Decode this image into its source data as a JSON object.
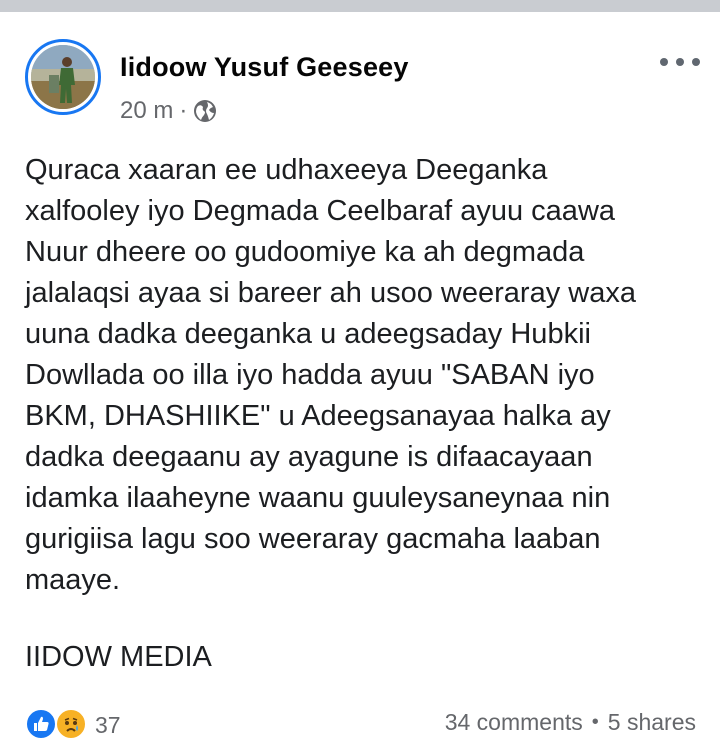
{
  "post": {
    "author": "Iidoow Yusuf Geeseey",
    "time": "20 m",
    "separator": "·",
    "privacy_icon": "globe-icon",
    "body": "Quraca xaaran ee udhaxeeya Deeganka\nxalfooley iyo Degmada Ceelbaraf ayuu caawa\nNuur dheere oo gudoomiye ka ah degmada\njalalaqsi ayaa si bareer ah usoo weeraray waxa\nuuna dadka deeganka u adeegsaday Hubkii\nDowllada oo illa iyo hadda ayuu \"SABAN iyo\nBKM, DHASHIIKE\" u Adeegsanayaa halka ay\ndadka deegaanu ay ayagune is difaacayaan\nidamka ilaaheyne waanu guuleysaneynaa nin\ngurigiisa lagu soo weeraray gacmaha laaban\nmaaye.",
    "signature": "IIDOW MEDIA"
  },
  "footer": {
    "reaction_icons": [
      "like-icon",
      "sad-icon"
    ],
    "reaction_count": "37",
    "comments": "34 comments",
    "dot": "•",
    "shares": "5 shares"
  },
  "colors": {
    "accent": "#1877f2",
    "secondary_text": "#65676b",
    "sad_reaction": "#f7b125",
    "top_bar": "#c9ccd1"
  }
}
